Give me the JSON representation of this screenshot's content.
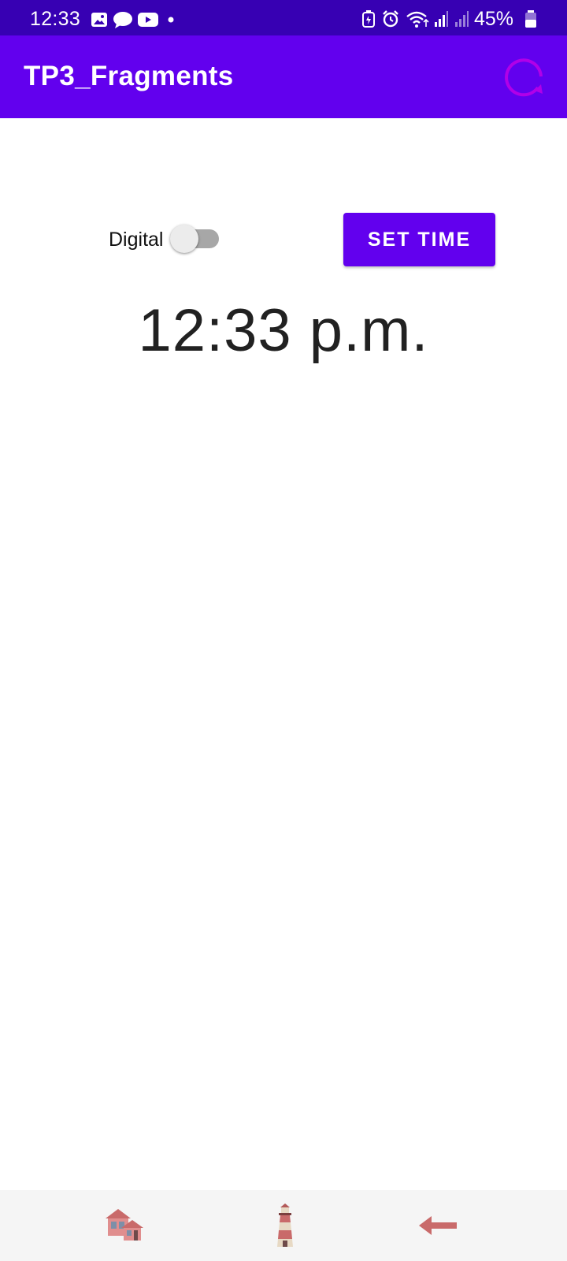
{
  "status_bar": {
    "time": "12:33",
    "battery_percent": "45%",
    "notification_icons": [
      "gallery-icon",
      "chat-icon",
      "youtube-icon",
      "dot-icon"
    ],
    "system_icons": [
      "battery-saver-icon",
      "alarm-icon",
      "wifi-icon",
      "signal-icon",
      "signal-icon",
      "battery-icon"
    ]
  },
  "app_bar": {
    "title": "TP3_Fragments",
    "action_icon": "refresh-icon",
    "color": "#6200ee"
  },
  "controls": {
    "toggle_label": "Digital",
    "toggle_on": false,
    "set_time_label": "SET TIME"
  },
  "clock": {
    "display": "12:33 p.m."
  },
  "bottom_nav": {
    "items": [
      "houses-icon",
      "lighthouse-icon",
      "left-arrow-icon"
    ]
  },
  "colors": {
    "status_bar": "#3700b3",
    "accent": "#6200ee",
    "refresh_icon": "#b100e8",
    "nav_icon": "#c96a6a"
  }
}
